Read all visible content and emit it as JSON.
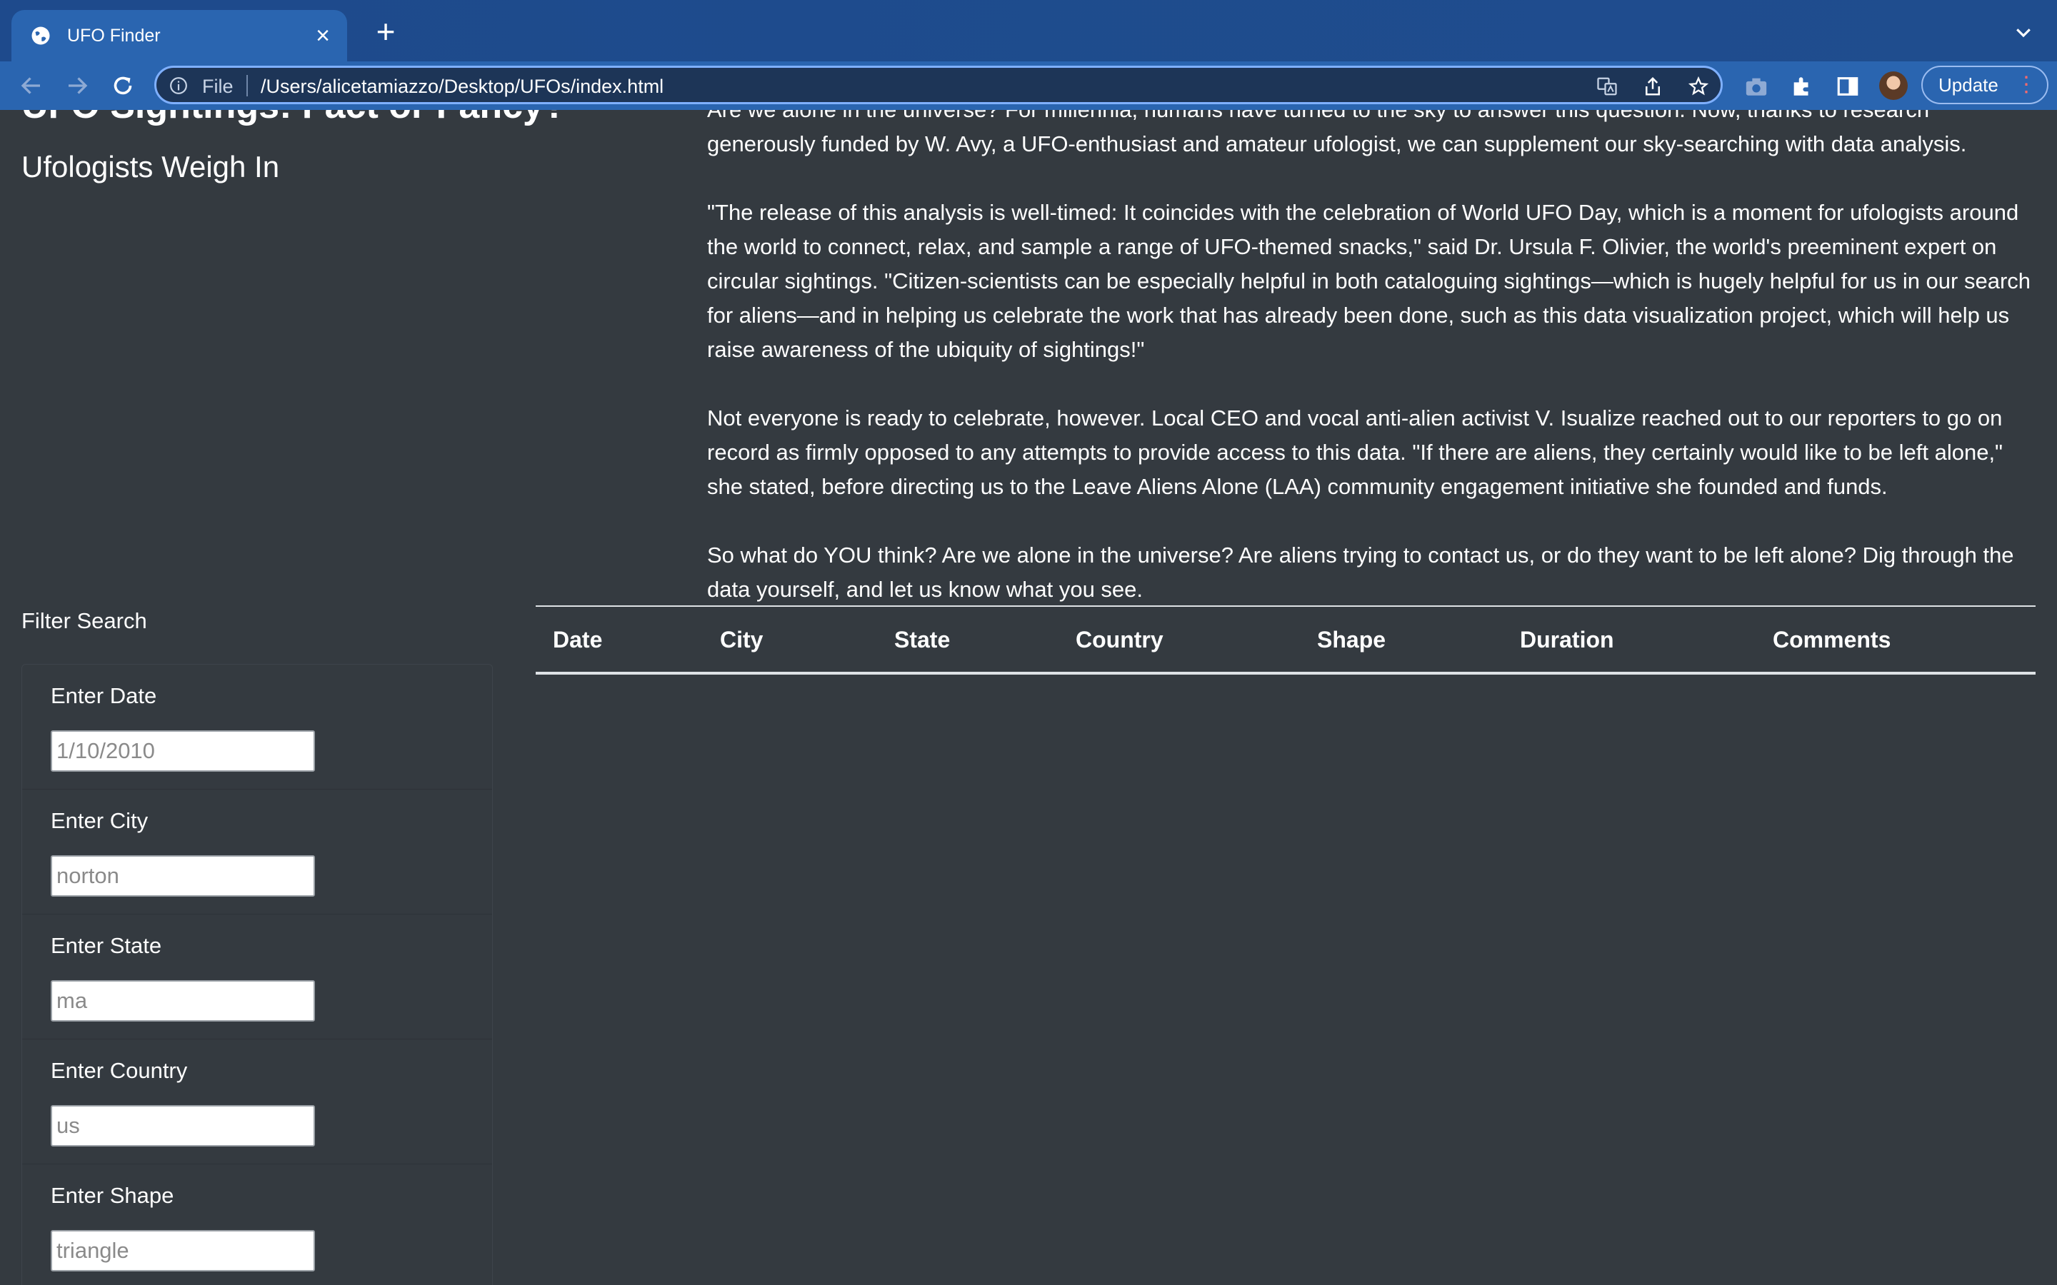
{
  "browser": {
    "tab_title": "UFO Finder",
    "address_scheme": "File",
    "address_url": "/Users/alicetamiazzo/Desktop/UFOs/index.html",
    "update_label": "Update"
  },
  "header": {
    "title": "UFO Sightings: Fact or Fancy?",
    "subtitle": "Ufologists Weigh In"
  },
  "article": {
    "paragraphs": [
      "Are we alone in the universe? For millennia, humans have turned to the sky to answer this question. Now, thanks to research generously funded by W. Avy, a UFO-enthusiast and amateur ufologist, we can supplement our sky-searching with data analysis.",
      "\"The release of this analysis is well-timed: It coincides with the celebration of World UFO Day, which is a moment for ufologists around the world to connect, relax, and sample a range of UFO-themed snacks,\" said Dr. Ursula F. Olivier, the world's preeminent expert on circular sightings. \"Citizen-scientists can be especially helpful in both cataloguing sightings—which is hugely helpful for us in our search for aliens—and in helping us celebrate the work that has already been done, such as this data visualization project, which will help us raise awareness of the ubiquity of sightings!\"",
      "Not everyone is ready to celebrate, however. Local CEO and vocal anti-alien activist V. Isualize reached out to our reporters to go on record as firmly opposed to any attempts to provide access to this data. \"If there are aliens, they certainly would like to be left alone,\" she stated, before directing us to the Leave Aliens Alone (LAA) community engagement initiative she founded and funds.",
      "So what do YOU think? Are we alone in the universe? Are aliens trying to contact us, or do they want to be left alone? Dig through the data yourself, and let us know what you see."
    ]
  },
  "filters": {
    "title": "Filter Search",
    "items": [
      {
        "label": "Enter Date",
        "placeholder": "1/10/2010"
      },
      {
        "label": "Enter City",
        "placeholder": "norton"
      },
      {
        "label": "Enter State",
        "placeholder": "ma"
      },
      {
        "label": "Enter Country",
        "placeholder": "us"
      },
      {
        "label": "Enter Shape",
        "placeholder": "triangle"
      }
    ]
  },
  "table": {
    "headers": [
      "Date",
      "City",
      "State",
      "Country",
      "Shape",
      "Duration",
      "Comments"
    ]
  }
}
